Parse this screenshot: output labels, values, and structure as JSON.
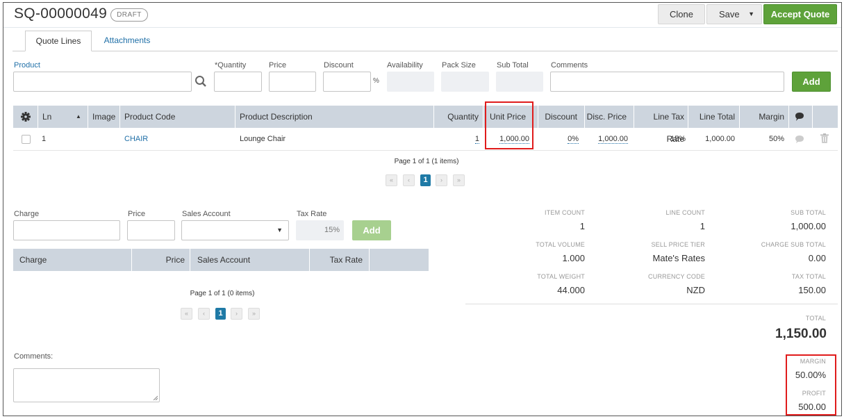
{
  "header": {
    "title": "SQ-00000049",
    "badge": "DRAFT",
    "clone_label": "Clone",
    "save_label": "Save",
    "accept_label": "Accept Quote"
  },
  "tabs": [
    {
      "label": "Quote Lines",
      "active": true
    },
    {
      "label": "Attachments",
      "active": false
    }
  ],
  "line_form": {
    "product_label": "Product",
    "quantity_label": "*Quantity",
    "price_label": "Price",
    "discount_label": "Discount",
    "discount_suffix": "%",
    "availability_label": "Availability",
    "pack_size_label": "Pack Size",
    "sub_total_label": "Sub Total",
    "comments_label": "Comments",
    "add_label": "Add"
  },
  "lines_table": {
    "columns": [
      "Ln",
      "Image",
      "Product Code",
      "Product Description",
      "Quantity",
      "Unit Price",
      "Discount",
      "Disc. Price",
      "Line Tax Rate",
      "Line Total",
      "Margin"
    ],
    "rows": [
      {
        "ln": "1",
        "image": "",
        "code": "CHAIR",
        "description": "Lounge Chair",
        "quantity": "1",
        "unit_price": "1,000.00",
        "discount": "0%",
        "disc_price": "1,000.00",
        "tax_rate": "15%",
        "line_total": "1,000.00",
        "margin": "50%"
      }
    ],
    "pagination": "Page 1 of 1 (1 items)",
    "current_page": "1"
  },
  "charge_form": {
    "charge_label": "Charge",
    "price_label": "Price",
    "sales_account_label": "Sales Account",
    "tax_rate_label": "Tax Rate",
    "tax_rate_value": "15%",
    "add_label": "Add"
  },
  "charges_table": {
    "columns": [
      "Charge",
      "Price",
      "Sales Account",
      "Tax Rate"
    ],
    "pagination": "Page 1 of 1 (0 items)",
    "current_page": "1"
  },
  "comments_label": "Comments:",
  "summary": {
    "item_count_label": "ITEM COUNT",
    "item_count": "1",
    "line_count_label": "LINE COUNT",
    "line_count": "1",
    "sub_total_label": "SUB TOTAL",
    "sub_total": "1,000.00",
    "total_volume_label": "TOTAL VOLUME",
    "total_volume": "1.000",
    "sell_price_tier_label": "SELL PRICE TIER",
    "sell_price_tier": "Mate's Rates",
    "charge_sub_total_label": "CHARGE SUB TOTAL",
    "charge_sub_total": "0.00",
    "total_weight_label": "TOTAL WEIGHT",
    "total_weight": "44.000",
    "currency_code_label": "CURRENCY CODE",
    "currency_code": "NZD",
    "tax_total_label": "TAX TOTAL",
    "tax_total": "150.00",
    "total_label": "TOTAL",
    "total": "1,150.00",
    "margin_label": "MARGIN",
    "margin": "50.00%",
    "profit_label": "PROFIT",
    "profit": "500.00"
  },
  "colors": {
    "accent_green": "#5ea23a",
    "link_blue": "#1f6fa7",
    "table_header": "#cdd5de",
    "highlight_red": "#e01b1b"
  }
}
